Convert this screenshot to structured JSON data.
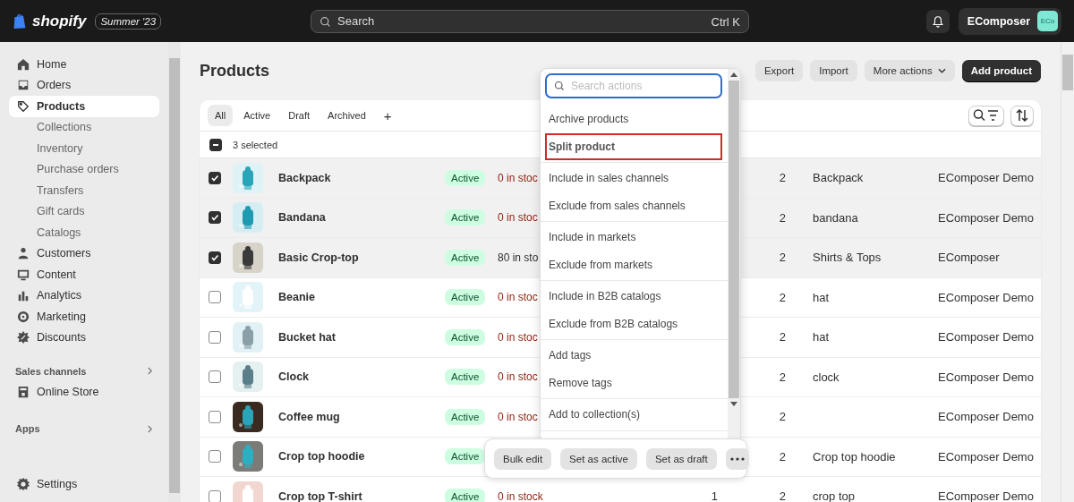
{
  "topbar": {
    "brand": "shopify",
    "edition": "Summer '23",
    "search": {
      "placeholder": "Search",
      "shortcut": "Ctrl K"
    },
    "account": {
      "name": "EComposer",
      "initials": "ECo"
    }
  },
  "sidebar": {
    "groups": [
      {
        "items": [
          {
            "label": "Home",
            "selected": false
          },
          {
            "label": "Orders",
            "selected": false
          },
          {
            "label": "Products",
            "selected": true,
            "children": [
              {
                "label": "Collections",
                "selected": false
              },
              {
                "label": "Inventory",
                "selected": false
              },
              {
                "label": "Purchase orders",
                "selected": false
              },
              {
                "label": "Transfers",
                "selected": false
              },
              {
                "label": "Gift cards",
                "selected": false
              },
              {
                "label": "Catalogs",
                "selected": false
              }
            ]
          },
          {
            "label": "Customers",
            "selected": false
          },
          {
            "label": "Content",
            "selected": false
          },
          {
            "label": "Analytics",
            "selected": false
          },
          {
            "label": "Marketing",
            "selected": false
          },
          {
            "label": "Discounts",
            "selected": false
          }
        ]
      },
      {
        "heading": "Sales channels",
        "items": [
          {
            "label": "Online Store",
            "selected": false
          }
        ]
      },
      {
        "heading": "Apps"
      }
    ],
    "footer": {
      "label": "Settings",
      "selected": false
    }
  },
  "page": {
    "title": "Products",
    "actions": [
      {
        "label": "Export",
        "kind": "secondary"
      },
      {
        "label": "Import",
        "kind": "secondary"
      },
      {
        "label": "More actions",
        "kind": "menu"
      },
      {
        "label": "Add product",
        "kind": "primary"
      }
    ]
  },
  "table": {
    "tabs": [
      {
        "label": "All",
        "selected": true
      },
      {
        "label": "Active",
        "selected": false
      },
      {
        "label": "Draft",
        "selected": false
      },
      {
        "label": "Archived",
        "selected": false
      }
    ],
    "add_tab": "+",
    "selection": {
      "label": "3 selected",
      "indeterminate": true
    },
    "rows": [
      {
        "checked": true,
        "name": "Backpack",
        "status": "Active",
        "inventory": "0 in stoc",
        "column_7": "2",
        "type": "Backpack",
        "vendor": "EComposer Demo"
      },
      {
        "checked": true,
        "name": "Bandana",
        "status": "Active",
        "inventory": "0 in stoc",
        "column_7": "2",
        "type": "bandana",
        "vendor": "EComposer Demo"
      },
      {
        "checked": true,
        "name": "Basic Crop-top",
        "status": "Active",
        "inventory": "80 in sto",
        "column_7": "2",
        "type": "Shirts & Tops",
        "vendor": "EComposer"
      },
      {
        "checked": false,
        "name": "Beanie",
        "status": "Active",
        "inventory": "0 in stoc",
        "column_7": "2",
        "type": "hat",
        "vendor": "EComposer Demo"
      },
      {
        "checked": false,
        "name": "Bucket hat",
        "status": "Active",
        "inventory": "0 in stoc",
        "column_7": "2",
        "type": "hat",
        "vendor": "EComposer Demo"
      },
      {
        "checked": false,
        "name": "Clock",
        "status": "Active",
        "inventory": "0 in stoc",
        "column_7": "2",
        "type": "clock",
        "vendor": "EComposer Demo"
      },
      {
        "checked": false,
        "name": "Coffee mug",
        "status": "Active",
        "inventory": "0 in stoc",
        "column_7": "2",
        "vendor": "EComposer Demo"
      },
      {
        "checked": false,
        "name": "Crop top hoodie",
        "status": "Active",
        "column_7": "2",
        "type": "Crop top hoodie",
        "vendor": "EComposer Demo"
      },
      {
        "checked": false,
        "name": "Crop top T-shirt",
        "status": "Active",
        "inventory": "0 in stock",
        "column_6": "1",
        "column_7": "2",
        "type": "crop top",
        "vendor": "EComposer Demo"
      }
    ]
  },
  "actions_menu": {
    "placeholder": "Search actions",
    "groups": [
      {
        "items": [
          {
            "label": "Archive products",
            "outlined": false
          },
          {
            "label": "Split product",
            "outlined": true
          }
        ]
      },
      {
        "items": [
          {
            "label": "Include in sales channels",
            "outlined": false
          },
          {
            "label": "Exclude from sales channels",
            "outlined": false
          }
        ]
      },
      {
        "items": [
          {
            "label": "Include in markets",
            "outlined": false
          },
          {
            "label": "Exclude from markets",
            "outlined": false
          }
        ]
      },
      {
        "items": [
          {
            "label": "Include in B2B catalogs",
            "outlined": false
          },
          {
            "label": "Exclude from B2B catalogs",
            "outlined": false
          }
        ]
      },
      {
        "items": [
          {
            "label": "Add tags",
            "outlined": false
          },
          {
            "label": "Remove tags",
            "outlined": false
          }
        ]
      },
      {
        "items": [
          {
            "label": "Add to collection(s)",
            "outlined": false
          }
        ]
      }
    ]
  },
  "bulk_bar": {
    "buttons": [
      {
        "label": "Bulk edit"
      },
      {
        "label": "Set as active"
      },
      {
        "label": "Set as draft"
      }
    ]
  }
}
